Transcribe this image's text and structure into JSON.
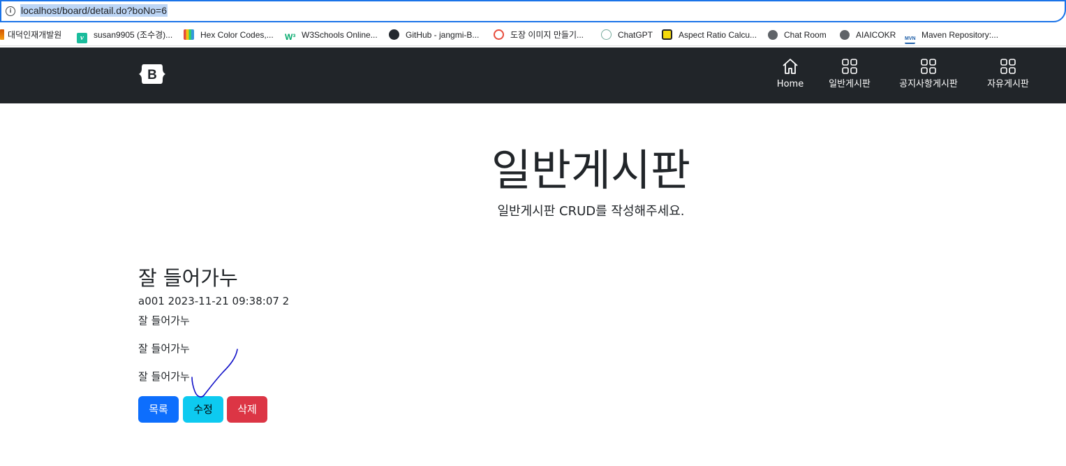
{
  "browser": {
    "url": "localhost/board/detail.do?boNo=6",
    "bookmarks": [
      {
        "label": "대덕인재개발원",
        "icon": "bookmark-icon"
      },
      {
        "label": "susan9905 (조수경)...",
        "icon": "v-logo-icon"
      },
      {
        "label": "Hex Color Codes,...",
        "icon": "color-book-icon"
      },
      {
        "label": "W3Schools Online...",
        "icon": "w3schools-icon"
      },
      {
        "label": "GitHub - jangmi-B...",
        "icon": "github-icon"
      },
      {
        "label": "도장 이미지 만들기...",
        "icon": "stamp-icon"
      },
      {
        "label": "ChatGPT",
        "icon": "chatgpt-icon"
      },
      {
        "label": "Aspect Ratio Calcu...",
        "icon": "aspect-ratio-icon"
      },
      {
        "label": "Chat Room",
        "icon": "globe-icon"
      },
      {
        "label": "AIAICOKR",
        "icon": "globe-icon"
      },
      {
        "label": "Maven Repository:...",
        "icon": "maven-icon"
      }
    ]
  },
  "navbar": {
    "brand": "B",
    "items": [
      {
        "label": "Home",
        "icon": "home-icon"
      },
      {
        "label": "일반게시판",
        "icon": "grid-icon"
      },
      {
        "label": "공지사항게시판",
        "icon": "grid-icon"
      },
      {
        "label": "자유게시판",
        "icon": "grid-icon"
      }
    ]
  },
  "hero": {
    "title": "일반게시판",
    "subtitle": "일반게시판 CRUD를 작성해주세요."
  },
  "post": {
    "title": "잘 들어가누",
    "meta": "a001 2023-11-21 09:38:07 2",
    "body": [
      "잘 들어가누",
      "잘 들어가누",
      "잘 들어가누"
    ]
  },
  "buttons": {
    "list": "목록",
    "edit": "수정",
    "delete": "삭제"
  },
  "colors": {
    "navbar_bg": "#212529",
    "primary": "#0d6efd",
    "info": "#0dcaf0",
    "danger": "#dc3545",
    "annotation": "#1010c8"
  }
}
